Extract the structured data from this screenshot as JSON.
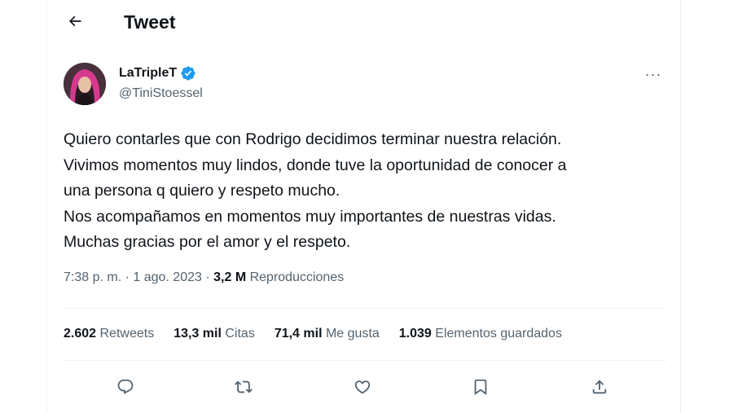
{
  "header": {
    "title": "Tweet",
    "back_icon": "arrow-left-icon"
  },
  "author": {
    "display_name": "LaTripleT",
    "handle": "@TiniStoessel",
    "verified_color": "#1d9bf0"
  },
  "tweet": {
    "lines": [
      "Quiero contarles que con Rodrigo decidimos terminar nuestra relación.",
      "Vivimos momentos muy lindos, donde tuve la oportunidad de conocer a",
      "una persona q quiero y respeto mucho.",
      "Nos acompañamos en momentos muy importantes de nuestras vidas.",
      "Muchas gracias por el amor y el respeto."
    ],
    "time": "7:38 p. m.",
    "sep1": " · ",
    "date": "1 ago. 2023",
    "sep2": " · ",
    "views": "3,2 M",
    "views_label": "Reproducciones"
  },
  "stats": [
    {
      "num": "2.602",
      "label": "Retweets"
    },
    {
      "num": "13,3 mil",
      "label": "Citas"
    },
    {
      "num": "71,4 mil",
      "label": "Me gusta"
    },
    {
      "num": "1.039",
      "label": "Elementos guardados"
    }
  ],
  "actions": [
    "reply-icon",
    "retweet-icon",
    "like-icon",
    "bookmark-icon",
    "share-icon"
  ],
  "more_label": "···"
}
